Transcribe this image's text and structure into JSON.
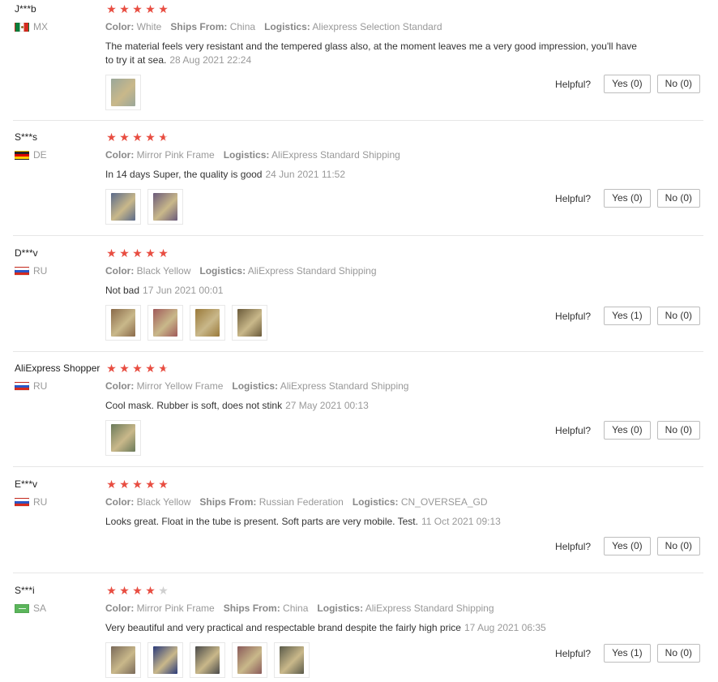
{
  "labels": {
    "helpful": "Helpful?",
    "color": "Color:",
    "ships_from": "Ships From:",
    "logistics": "Logistics:"
  },
  "colors": {
    "star": "#e84d41",
    "star_empty": "#d0d0d0",
    "divider": "#e6e6e6",
    "muted": "#999999"
  },
  "reviews": [
    {
      "user": "J***b",
      "country": "MX",
      "flag": "mx",
      "rating": 5,
      "color": "White",
      "ships_from": "China",
      "logistics": "Aliexpress Selection Standard",
      "text": "The material feels very resistant and the tempered glass also, at the moment leaves me a very good impression, you'll have to try it at sea.",
      "date": "28 Aug 2021 22:24",
      "yes": "Yes (0)",
      "no": "No (0)",
      "photos": [
        "#9aa79a"
      ]
    },
    {
      "user": "S***s",
      "country": "DE",
      "flag": "de",
      "rating": 4.5,
      "color": "Mirror Pink Frame",
      "logistics": "AliExpress Standard Shipping",
      "text": "In 14 days Super, the quality is good",
      "date": "24 Jun 2021 11:52",
      "yes": "Yes (0)",
      "no": "No (0)",
      "photos": [
        "#5a6a8a",
        "#6a5a7a"
      ]
    },
    {
      "user": "D***v",
      "country": "RU",
      "flag": "ru",
      "rating": 5,
      "color": "Black Yellow",
      "logistics": "AliExpress Standard Shipping",
      "text": "Not bad",
      "date": "17 Jun 2021 00:01",
      "yes": "Yes (1)",
      "no": "No (0)",
      "photos": [
        "#8a6a4a",
        "#a05a5a",
        "#9a7a3a",
        "#6a5a3a"
      ]
    },
    {
      "user": "AliExpress Shopper",
      "country": "RU",
      "flag": "ru",
      "rating": 4.5,
      "color": "Mirror Yellow Frame",
      "logistics": "AliExpress Standard Shipping",
      "text": "Cool mask. Rubber is soft, does not stink",
      "date": "27 May 2021 00:13",
      "yes": "Yes (0)",
      "no": "No (0)",
      "photos": [
        "#6a7a5a"
      ]
    },
    {
      "user": "E***v",
      "country": "RU",
      "flag": "ru",
      "rating": 5,
      "color": "Black Yellow",
      "ships_from": "Russian Federation",
      "logistics": "CN_OVERSEA_GD",
      "text": "Looks great. Float in the tube is present. Soft parts are very mobile. Test.",
      "date": "11 Oct 2021 09:13",
      "yes": "Yes (0)",
      "no": "No (0)",
      "photos": []
    },
    {
      "user": "S***i",
      "country": "SA",
      "flag": "sa",
      "rating": 4,
      "color": "Mirror Pink Frame",
      "ships_from": "China",
      "logistics": "AliExpress Standard Shipping",
      "text": "Very beautiful and very practical and respectable brand despite the fairly high price",
      "date": "17 Aug 2021 06:35",
      "yes": "Yes (1)",
      "no": "No (0)",
      "photos": [
        "#7a6a5a",
        "#2a3a7a",
        "#4a4a4a",
        "#8a5a5a",
        "#5a5a4a"
      ]
    }
  ]
}
